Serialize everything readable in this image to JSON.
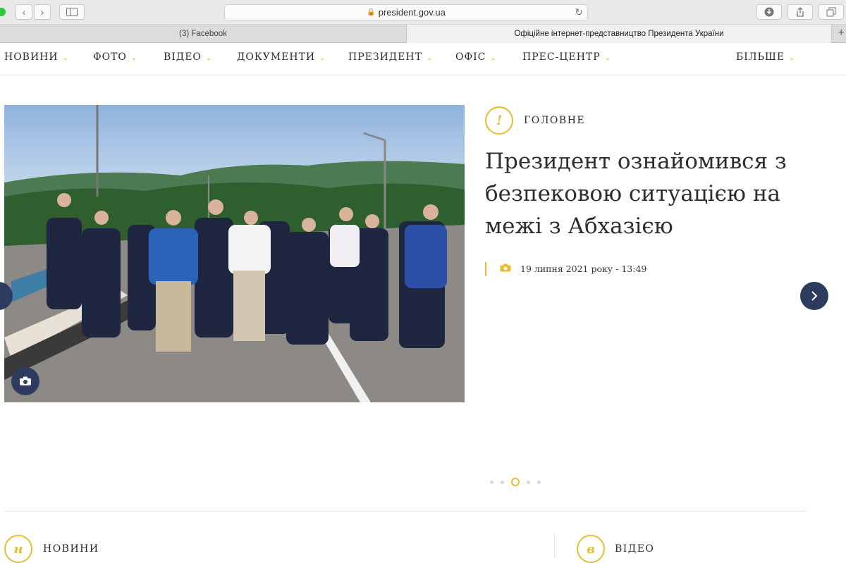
{
  "browser": {
    "url": "president.gov.ua",
    "tabs": [
      {
        "label": "(3) Facebook"
      },
      {
        "label": "Офіційне інтернет-представництво Президента України"
      }
    ]
  },
  "nav": {
    "items": [
      "НОВИНИ",
      "ФОТО",
      "ВІДЕО",
      "ДОКУМЕНТИ",
      "ПРЕЗИДЕНТ",
      "ОФІС",
      "ПРЕС-ЦЕНТР"
    ],
    "more": "БІЛЬШЕ"
  },
  "hero": {
    "section_icon": "!",
    "section": "ГОЛОВНЕ",
    "title": "Президент ознайомився з безпековою ситуацією на межі з Абхазією",
    "date": "19 липня 2021 року - 13:49",
    "slide_count": 5,
    "active_slide": 3
  },
  "sections": [
    {
      "icon": "н",
      "title": "НОВИНИ"
    },
    {
      "icon": "в",
      "title": "ВІДЕО"
    }
  ],
  "colors": {
    "accent": "#e5bd31",
    "nav_button": "#2c3b5e",
    "text": "#2d2d2d"
  },
  "icons": [
    "lock-icon",
    "reload-icon",
    "back-icon",
    "forward-icon",
    "sidebar-icon",
    "download-icon",
    "share-icon",
    "tabs-icon",
    "camera-icon",
    "chevron-right-icon",
    "chevron-left-icon",
    "chevron-down-icon"
  ]
}
